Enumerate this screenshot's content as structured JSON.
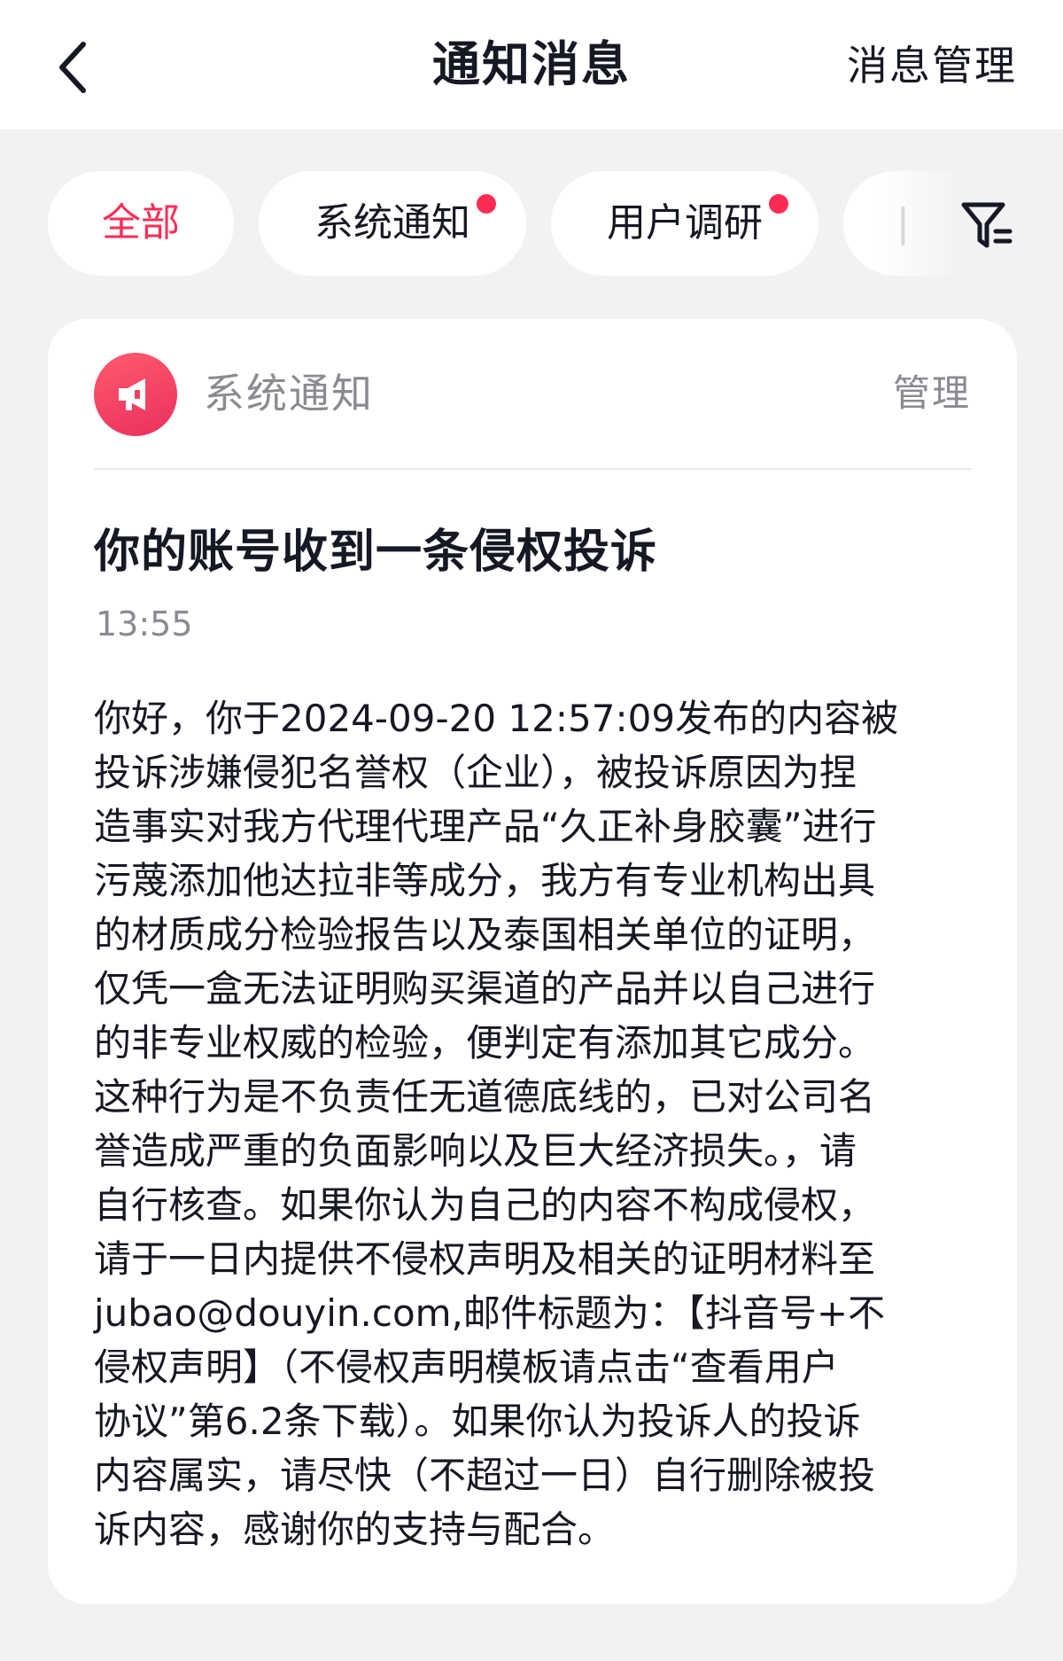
{
  "header": {
    "title": "通知消息",
    "manage_label": "消息管理",
    "back_icon": "chevron-left-icon"
  },
  "tabs": [
    {
      "label": "全部",
      "active": true,
      "has_dot": false
    },
    {
      "label": "系统通知",
      "active": false,
      "has_dot": true
    },
    {
      "label": "用户调研",
      "active": false,
      "has_dot": true
    },
    {
      "label": "|",
      "active": false,
      "has_dot": false
    }
  ],
  "filter_icon": "filter-icon",
  "accent_color": "#fe2c55",
  "message": {
    "source": "系统通知",
    "source_icon": "megaphone-icon",
    "manage_label": "管理",
    "title": "你的账号收到一条侵权投诉",
    "time": "13:55",
    "body_lines": [
      "你好，你于2024-09-20 12:57:09发布的内容被",
      "投诉涉嫌侵犯名誉权（企业），被投诉原因为捏",
      "造事实对我方代理代理产品“久正补身胶囊”进行",
      "污蔑添加他达拉非等成分，我方有专业机构出具",
      "的材质成分检验报告以及泰国相关单位的证明，",
      "仅凭一盒无法证明购买渠道的产品并以自己进行",
      "的非专业权威的检验，便判定有添加其它成分。",
      "这种行为是不负责任无道德底线的，已对公司名",
      "誉造成严重的负面影响以及巨大经济损失。，请",
      "自行核查。如果你认为自己的内容不构成侵权，",
      "请于一日内提供不侵权声明及相关的证明材料至",
      "jubao@douyin.com,邮件标题为：【抖音号+不",
      "侵权声明】（不侵权声明模板请点击“查看用户",
      "协议”第6.2条下载）。如果你认为投诉人的投诉",
      "内容属实，请尽快（不超过一日）自行删除被投",
      "诉内容，感谢你的支持与配合。"
    ]
  }
}
